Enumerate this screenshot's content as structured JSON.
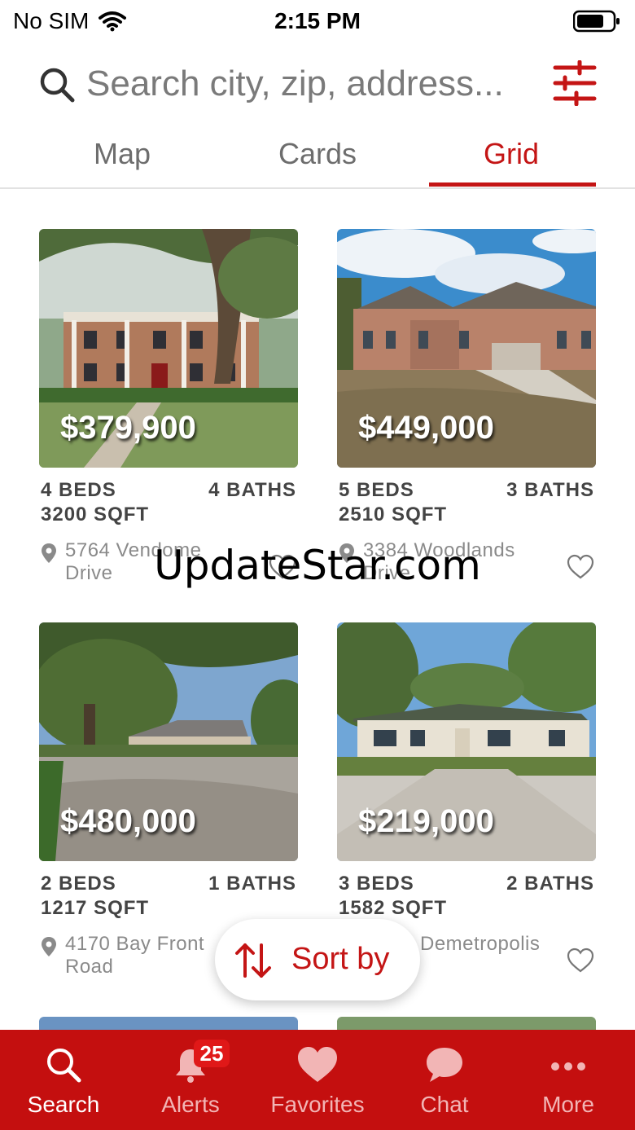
{
  "status_bar": {
    "carrier": "No SIM",
    "time": "2:15 PM"
  },
  "search": {
    "placeholder": "Search city, zip, address..."
  },
  "tabs": [
    {
      "label": "Map",
      "active": false
    },
    {
      "label": "Cards",
      "active": false
    },
    {
      "label": "Grid",
      "active": true
    }
  ],
  "listings": [
    {
      "price": "$379,900",
      "beds": "4 BEDS",
      "baths": "4 BATHS",
      "sqft": "3200 SQFT",
      "address": "5764 Vendome Drive"
    },
    {
      "price": "$449,000",
      "beds": "5 BEDS",
      "baths": "3 BATHS",
      "sqft": "2510 SQFT",
      "address": "3384 Woodlands Drive"
    },
    {
      "price": "$480,000",
      "beds": "2 BEDS",
      "baths": "1 BATHS",
      "sqft": "1217 SQFT",
      "address": "4170 Bay Front Road"
    },
    {
      "price": "$219,000",
      "beds": "3 BEDS",
      "baths": "2 BATHS",
      "sqft": "1582 SQFT",
      "address": "Demetropolis"
    }
  ],
  "sort_button": {
    "label": "Sort by"
  },
  "watermark": "UpdateStar.com",
  "nav": [
    {
      "label": "Search",
      "icon": "search-icon",
      "active": true
    },
    {
      "label": "Alerts",
      "icon": "bell-icon",
      "badge": "25"
    },
    {
      "label": "Favorites",
      "icon": "heart-icon"
    },
    {
      "label": "Chat",
      "icon": "chat-bubble-icon"
    },
    {
      "label": "More",
      "icon": "more-dots-icon"
    }
  ],
  "colors": {
    "accent": "#c41515",
    "nav_background": "#c40f0f",
    "badge": "#e01818"
  }
}
